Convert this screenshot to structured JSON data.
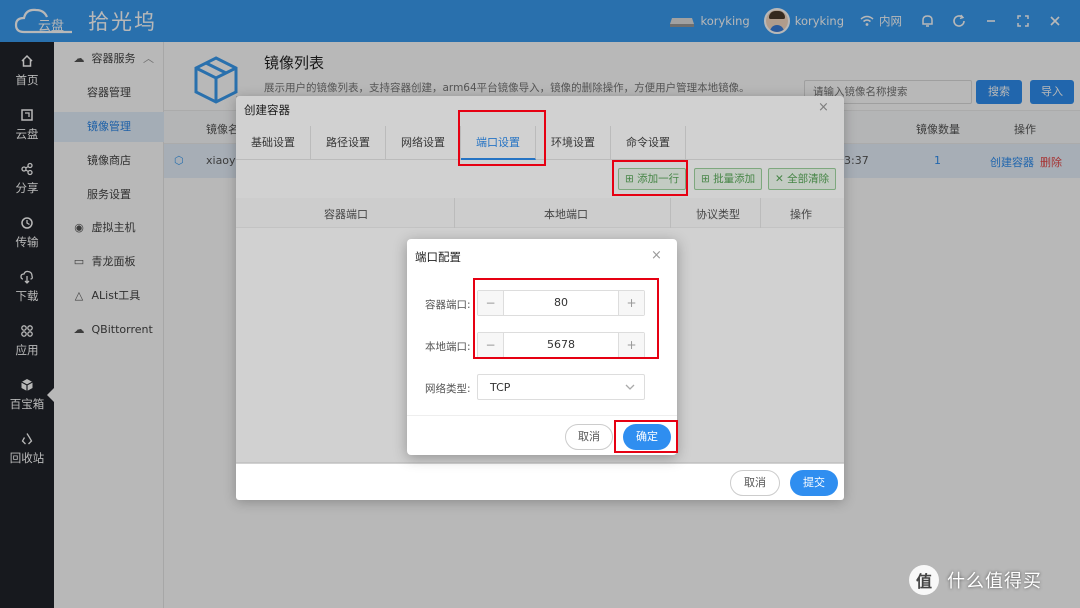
{
  "app": {
    "logo_sub": "云盘",
    "name": "拾光坞"
  },
  "topbar": {
    "device": "koryking",
    "user": "koryking",
    "network": "内网"
  },
  "rail": {
    "items": [
      {
        "label": "首页",
        "icon": "home-icon"
      },
      {
        "label": "云盘",
        "icon": "cloud-drive-icon"
      },
      {
        "label": "分享",
        "icon": "share-icon"
      },
      {
        "label": "传输",
        "icon": "transfer-icon"
      },
      {
        "label": "下载",
        "icon": "download-icon"
      },
      {
        "label": "应用",
        "icon": "apps-icon"
      },
      {
        "label": "百宝箱",
        "icon": "toolbox-icon"
      },
      {
        "label": "回收站",
        "icon": "recycle-icon"
      }
    ]
  },
  "submenu": {
    "group": "容器服务",
    "children": [
      "容器管理",
      "镜像管理",
      "镜像商店",
      "服务设置"
    ],
    "others": [
      "虚拟主机",
      "青龙面板",
      "AList工具",
      "QBittorrent"
    ]
  },
  "main": {
    "title": "镜像列表",
    "description": "展示用户的镜像列表，支持容器创建，arm64平台镜像导入，镜像的删除操作，方便用户管理本地镜像。",
    "search_placeholder": "请输入镜像名称搜索",
    "search_button": "搜索",
    "import_button": "导入",
    "table": {
      "headers": [
        "镜像名",
        "镜像数量",
        "操作"
      ],
      "row": {
        "name": "xiaoyal",
        "time": "3:37",
        "count": "1",
        "create": "创建容器",
        "delete": "删除"
      }
    }
  },
  "create_dialog": {
    "title": "创建容器",
    "tabs": [
      "基础设置",
      "路径设置",
      "网络设置",
      "端口设置",
      "环境设置",
      "命令设置"
    ],
    "active_tab": "端口设置",
    "add_row": "添加一行",
    "batch_add": "批量添加",
    "clear_all": "全部清除",
    "columns": [
      "容器端口",
      "本地端口",
      "协议类型",
      "操作"
    ],
    "cancel": "取消",
    "submit": "提交"
  },
  "port_dialog": {
    "title": "端口配置",
    "container_port_label": "容器端口:",
    "container_port": "80",
    "local_port_label": "本地端口:",
    "local_port": "5678",
    "network_type_label": "网络类型:",
    "network_type": "TCP",
    "cancel": "取消",
    "confirm": "确定"
  },
  "watermark": {
    "badge": "值",
    "text": "什么值得买"
  },
  "colors": {
    "primary": "#2f8ef0",
    "titlebar": "#3a9bf0",
    "rail": "#20232a",
    "highlight": "#e60012"
  }
}
